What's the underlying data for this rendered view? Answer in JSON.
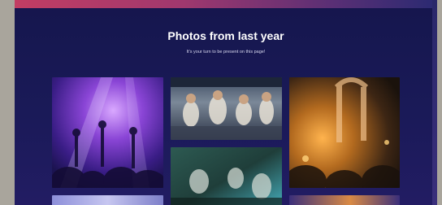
{
  "page": {
    "title": "Photos from last year",
    "subtitle": "It's your turn to be present on this page!"
  },
  "colors": {
    "background": "#16174f",
    "accent_bar_start": "#c23d63",
    "accent_bar_end": "#2a2a72",
    "text": "#ffffff"
  },
  "gallery": {
    "photos": [
      {
        "name": "concert-crowd-purple-lights"
      },
      {
        "name": "festival-crowd-daylight"
      },
      {
        "name": "crowd-heart-hands-warm-lights"
      },
      {
        "name": "crowd-closeup-green-tones"
      },
      {
        "name": "stage-lights-partial"
      },
      {
        "name": "warm-light-partial"
      }
    ]
  }
}
